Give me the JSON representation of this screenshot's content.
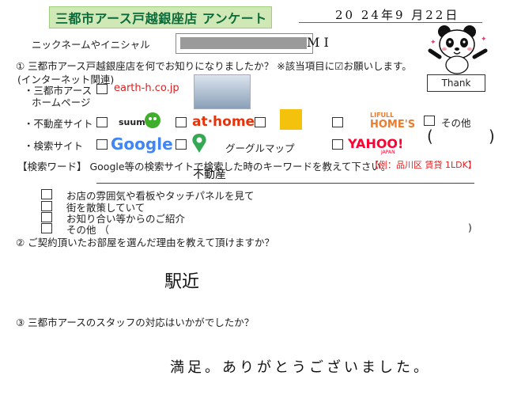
{
  "header": {
    "title": "三都市アース戸越銀座店 アンケート",
    "date": "20 24年9 月22日"
  },
  "nickname": {
    "label": "ニックネームやイニシャル",
    "value": "M I"
  },
  "decoration": {
    "thank": "Thank"
  },
  "q1": {
    "question": "① 三都市アース戸越銀座店を何でお知りになりましたか？ ※該当項目に☑お願いします。",
    "internet_label": "(インターネット関連)",
    "hp_label_line1": "・三都市アース",
    "hp_label_line2": "ホームページ",
    "hp_url": "earth-h.co.jp",
    "realestate_label": "・不動産サイト",
    "suumo": "suumo",
    "athome": "at·home",
    "lifull_small": "LIFULL",
    "lifull_big": "HOME'S",
    "other_label": "その他",
    "search_label": "・検索サイト",
    "google": "Google",
    "googlemap_label": "グーグルマップ",
    "yahoo": "YAHOO!",
    "yahoo_sub": "JAPAN",
    "keyword_label": "【検索ワード】 Google等の検索サイトで検索した時のキーワードを教えて下さい。",
    "keyword_example": "【例：品川区 賃貸 1LDK】",
    "keyword_answer": "不動産",
    "opt1": "お店の雰囲気や看板やタッチパネルを見て",
    "opt2": "街を散策していて",
    "opt3": "お知り合い等からのご紹介",
    "opt4": "その他 （"
  },
  "q2": {
    "question": "② ご契約頂いたお部屋を選んだ理由を教えて頂けますか？",
    "answer": "駅近"
  },
  "q3": {
    "question": "③ 三都市アースのスタッフの対応はいかがでしたか？",
    "answer": "満足。ありがとうございました。"
  },
  "colors": {
    "title_green": "#0b6b3a",
    "title_bg": "#cfe8b6",
    "accent_red": "#e02020",
    "athome_red": "#e8330a",
    "lifull_orange": "#ee7c2a",
    "suumo_green": "#3fae2a"
  }
}
